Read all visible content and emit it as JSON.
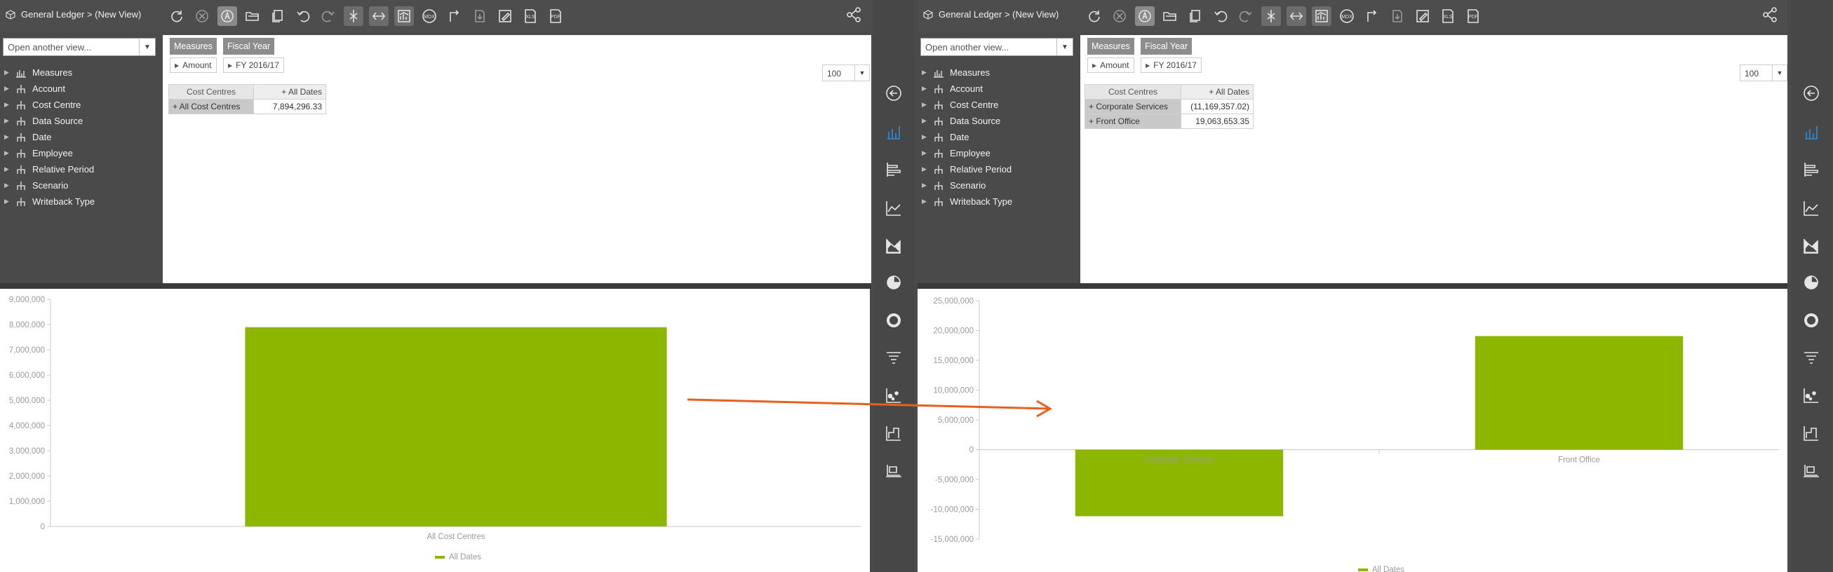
{
  "views": [
    {
      "breadcrumb": "General Ledger > (New View)",
      "view_selector_placeholder": "Open another view...",
      "tree": [
        "Measures",
        "Account",
        "Cost Centre",
        "Data Source",
        "Date",
        "Employee",
        "Relative Period",
        "Scenario",
        "Writeback Type"
      ],
      "chips": {
        "measures": "Measures",
        "measure_value": "Amount",
        "fiscal_year": "Fiscal Year",
        "fiscal_value": "FY 2016/17"
      },
      "rows_per_page": "100",
      "grid": {
        "row_header": "Cost Centres",
        "col_header": "+ All Dates",
        "rows": [
          {
            "label": "+ All Cost Centres",
            "value": "7,894,296.33"
          }
        ]
      },
      "chart_data": {
        "type": "bar",
        "categories": [
          "All Cost Centres"
        ],
        "series": [
          {
            "name": "All Dates",
            "values": [
              7894296.33
            ],
            "color": "#8db600"
          }
        ],
        "ylim": [
          0,
          9000000
        ],
        "yticks": [
          "9,000,000",
          "8,000,000",
          "7,000,000",
          "6,000,000",
          "5,000,000",
          "4,000,000",
          "3,000,000",
          "2,000,000",
          "1,000,000",
          "0"
        ],
        "legend": "bottom-center"
      }
    },
    {
      "breadcrumb": "General Ledger > (New View)",
      "view_selector_placeholder": "Open another view...",
      "tree": [
        "Measures",
        "Account",
        "Cost Centre",
        "Data Source",
        "Date",
        "Employee",
        "Relative Period",
        "Scenario",
        "Writeback Type"
      ],
      "chips": {
        "measures": "Measures",
        "measure_value": "Amount",
        "fiscal_year": "Fiscal Year",
        "fiscal_value": "FY 2016/17"
      },
      "rows_per_page": "100",
      "grid": {
        "row_header": "Cost Centres",
        "col_header": "+ All Dates",
        "rows": [
          {
            "label": "+ Corporate Services",
            "value": "(11,169,357.02)"
          },
          {
            "label": "+ Front Office",
            "value": "19,063,653.35"
          }
        ]
      },
      "chart_data": {
        "type": "bar",
        "categories": [
          "Corporate Services",
          "Front Office"
        ],
        "series": [
          {
            "name": "All Dates",
            "values": [
              -11169357.02,
              19063653.35
            ],
            "color": "#8db600"
          }
        ],
        "ylim": [
          -15000000,
          25000000
        ],
        "yticks": [
          "25,000,000",
          "20,000,000",
          "15,000,000",
          "10,000,000",
          "5,000,000",
          "0",
          "-5,000,000",
          "-10,000,000",
          "-15,000,000"
        ],
        "legend": "bottom-center"
      }
    }
  ],
  "accent_color": "#e8601c",
  "toolbar_icons": [
    "refresh-icon",
    "cancel-icon",
    "auto-icon",
    "open-folder-icon",
    "copy-icon",
    "undo-icon",
    "redo-icon",
    "collapse-icon",
    "expand-icon",
    "chart-icon",
    "mdx-icon",
    "swap-icon",
    "export-icon",
    "edit-icon",
    "xls-icon",
    "pdf-icon"
  ],
  "toolbar_text": {
    "mdx": "MDX",
    "xls": "XLS",
    "pdf": "PDF"
  },
  "rail_icons": [
    "back-icon",
    "column-chart-icon",
    "bar-chart-icon",
    "line-chart-icon",
    "area-chart-icon",
    "pie-chart-icon",
    "donut-chart-icon",
    "funnel-chart-icon",
    "scatter-chart-icon",
    "step-chart-icon",
    "display-icon"
  ]
}
